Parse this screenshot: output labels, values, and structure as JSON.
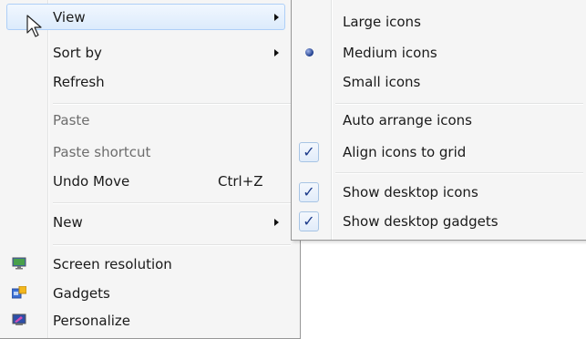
{
  "main_menu": {
    "view": "View",
    "sort_by": "Sort by",
    "refresh": "Refresh",
    "paste": "Paste",
    "paste_shortcut": "Paste shortcut",
    "undo_move": "Undo Move",
    "undo_shortcut": "Ctrl+Z",
    "new": "New",
    "screen_resolution": "Screen resolution",
    "gadgets": "Gadgets",
    "personalize": "Personalize"
  },
  "view_submenu": {
    "large_icons": "Large icons",
    "medium_icons": "Medium icons",
    "small_icons": "Small icons",
    "auto_arrange": "Auto arrange icons",
    "align_to_grid": "Align icons to grid",
    "show_desktop_icons": "Show desktop icons",
    "show_desktop_gadgets": "Show desktop gadgets",
    "check_mark": "✓"
  },
  "colors": {
    "menu_bg": "#f5f5f5",
    "highlight_border": "#aecff7",
    "check_color": "#1b3a8a"
  }
}
